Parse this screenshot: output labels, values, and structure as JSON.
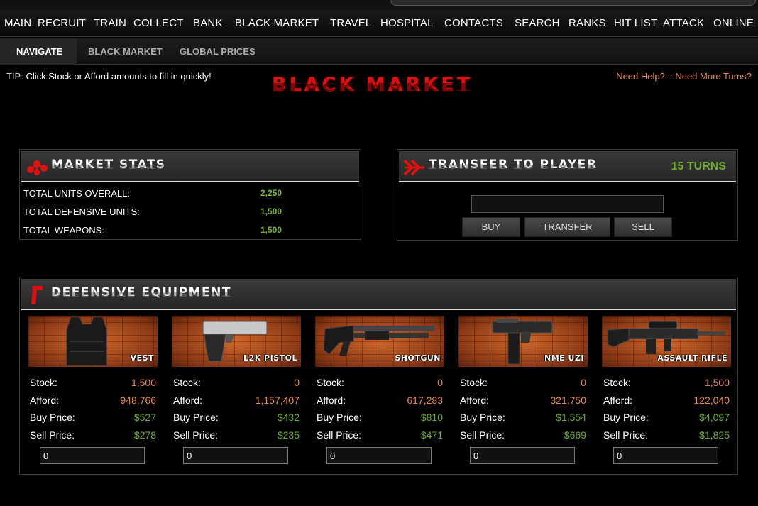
{
  "nav": {
    "main": [
      "MAIN",
      "RECRUIT",
      "TRAIN",
      "COLLECT",
      "BANK",
      "BLACK MARKET",
      "TRAVEL",
      "HOSPITAL",
      "CONTACTS",
      "SEARCH",
      "RANKS",
      "HIT LIST",
      "ATTACK",
      "ONLINE"
    ],
    "sub": [
      "NAVIGATE",
      "BLACK MARKET",
      "GLOBAL PRICES"
    ]
  },
  "tip": {
    "label": "TIP:",
    "text": "Click Stock or Afford amounts to fill in quickly!"
  },
  "help": {
    "need_help": "Need Help?",
    "sep": "::",
    "more_turns": "Need More Turns?"
  },
  "logo": "BLACK MARKET",
  "market_stats": {
    "title": "MARKET STATS",
    "rows": [
      {
        "label": "TOTAL UNITS OVERALL:",
        "value": "2,250"
      },
      {
        "label": "TOTAL DEFENSIVE UNITS:",
        "value": "1,500"
      },
      {
        "label": "TOTAL WEAPONS:",
        "value": "1,500"
      }
    ]
  },
  "transfer": {
    "title": "TRANSFER TO PLAYER",
    "turns": "15 TURNS",
    "input_value": "",
    "buttons": [
      "BUY",
      "TRANSFER",
      "SELL"
    ]
  },
  "defensive": {
    "title": "DEFENSIVE EQUIPMENT",
    "labels": {
      "stock": "Stock:",
      "afford": "Afford:",
      "buy": "Buy Price:",
      "sell": "Sell Price:"
    },
    "items": [
      {
        "name": "VEST",
        "stock": "1,500",
        "afford": "948,766",
        "buy": "$527",
        "sell": "$278",
        "qty": "0",
        "icon": "vest-icon"
      },
      {
        "name": "L2K PISTOL",
        "stock": "0",
        "afford": "1,157,407",
        "buy": "$432",
        "sell": "$235",
        "qty": "0",
        "icon": "pistol-icon"
      },
      {
        "name": "SHOTGUN",
        "stock": "0",
        "afford": "617,283",
        "buy": "$810",
        "sell": "$471",
        "qty": "0",
        "icon": "shotgun-icon"
      },
      {
        "name": "NME UZI",
        "stock": "0",
        "afford": "321,750",
        "buy": "$1,554",
        "sell": "$669",
        "qty": "0",
        "icon": "uzi-icon"
      },
      {
        "name": "ASSAULT RIFLE",
        "stock": "1,500",
        "afford": "122,040",
        "buy": "$4,097",
        "sell": "$1,825",
        "qty": "0",
        "icon": "rifle-icon"
      }
    ]
  },
  "colors": {
    "accent_red": "#e01010",
    "value_green": "#6eab2e",
    "value_orange": "#e8894a"
  }
}
